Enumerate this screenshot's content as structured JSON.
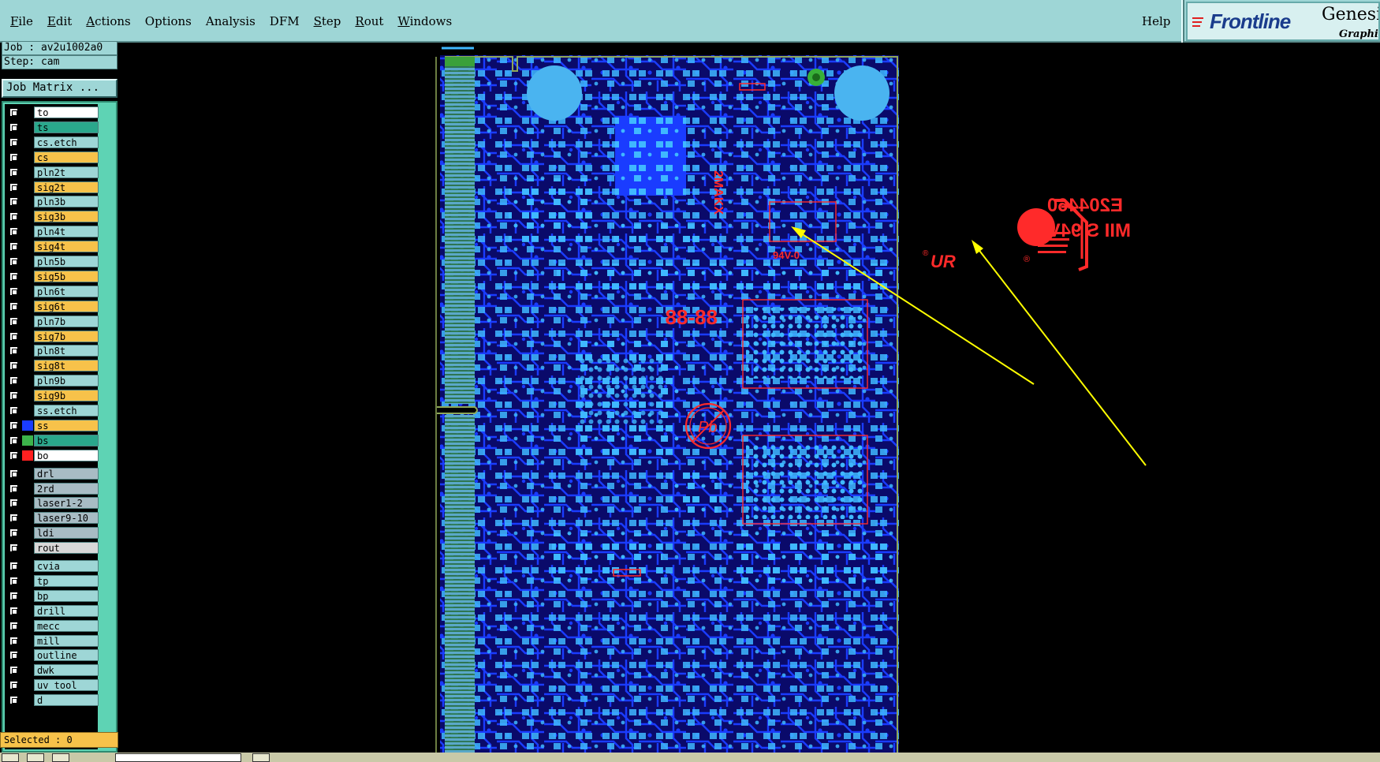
{
  "menu": {
    "items": [
      {
        "label": "File",
        "underline": "F"
      },
      {
        "label": "Edit",
        "underline": "E"
      },
      {
        "label": "Actions",
        "underline": "A"
      },
      {
        "label": "Options",
        "underline": ""
      },
      {
        "label": "Analysis",
        "underline": ""
      },
      {
        "label": "DFM",
        "underline": ""
      },
      {
        "label": "Step",
        "underline": "S"
      },
      {
        "label": "Rout",
        "underline": "R"
      },
      {
        "label": "Windows",
        "underline": "W"
      }
    ],
    "help": "Help"
  },
  "brand": {
    "logo_text": "Frontline",
    "product": "Genesis",
    "subtitle": "Graphic"
  },
  "job": {
    "job_line": "Job : av2u1002a0",
    "step_line": "Step: cam",
    "matrix_button": "Job Matrix ..."
  },
  "layers": [
    {
      "name": "to",
      "bg": "#ffffff",
      "swatch": ""
    },
    {
      "name": "ts",
      "bg": "#2aa88c",
      "swatch": ""
    },
    {
      "name": "cs.etch",
      "bg": "#9ed6d6",
      "swatch": ""
    },
    {
      "name": "cs",
      "bg": "#f7c24a",
      "swatch": ""
    },
    {
      "name": "pln2t",
      "bg": "#9ed6d6",
      "swatch": ""
    },
    {
      "name": "sig2t",
      "bg": "#f7c24a",
      "swatch": ""
    },
    {
      "name": "pln3b",
      "bg": "#9ed6d6",
      "swatch": ""
    },
    {
      "name": "sig3b",
      "bg": "#f7c24a",
      "swatch": ""
    },
    {
      "name": "pln4t",
      "bg": "#9ed6d6",
      "swatch": ""
    },
    {
      "name": "sig4t",
      "bg": "#f7c24a",
      "swatch": ""
    },
    {
      "name": "pln5b",
      "bg": "#9ed6d6",
      "swatch": ""
    },
    {
      "name": "sig5b",
      "bg": "#f7c24a",
      "swatch": ""
    },
    {
      "name": "pln6t",
      "bg": "#9ed6d6",
      "swatch": ""
    },
    {
      "name": "sig6t",
      "bg": "#f7c24a",
      "swatch": ""
    },
    {
      "name": "pln7b",
      "bg": "#9ed6d6",
      "swatch": ""
    },
    {
      "name": "sig7b",
      "bg": "#f7c24a",
      "swatch": ""
    },
    {
      "name": "pln8t",
      "bg": "#9ed6d6",
      "swatch": ""
    },
    {
      "name": "sig8t",
      "bg": "#f7c24a",
      "swatch": ""
    },
    {
      "name": "pln9b",
      "bg": "#9ed6d6",
      "swatch": ""
    },
    {
      "name": "sig9b",
      "bg": "#f7c24a",
      "swatch": ""
    },
    {
      "name": "ss.etch",
      "bg": "#9ed6d6",
      "swatch": ""
    },
    {
      "name": "ss",
      "bg": "#f7c24a",
      "swatch": "#1a3cff"
    },
    {
      "name": "bs",
      "bg": "#2aa88c",
      "swatch": "#3cb44b"
    },
    {
      "name": "bo",
      "bg": "#ffffff",
      "swatch": "#ff2020"
    },
    {
      "name": "drl",
      "bg": "#a8bcc4",
      "swatch": ""
    },
    {
      "name": "2rd",
      "bg": "#a8bcc4",
      "swatch": ""
    },
    {
      "name": "laser1-2",
      "bg": "#a8bcc4",
      "swatch": ""
    },
    {
      "name": "laser9-10",
      "bg": "#a8bcc4",
      "swatch": ""
    },
    {
      "name": "ldi",
      "bg": "#a8bcc4",
      "swatch": ""
    },
    {
      "name": "rout",
      "bg": "#d8d8d8",
      "swatch": ""
    },
    {
      "name": "cvia",
      "bg": "#9ed6d6",
      "swatch": ""
    },
    {
      "name": "tp",
      "bg": "#9ed6d6",
      "swatch": ""
    },
    {
      "name": "bp",
      "bg": "#9ed6d6",
      "swatch": ""
    },
    {
      "name": "drill",
      "bg": "#9ed6d6",
      "swatch": ""
    },
    {
      "name": "mecc",
      "bg": "#9ed6d6",
      "swatch": ""
    },
    {
      "name": "mill",
      "bg": "#9ed6d6",
      "swatch": ""
    },
    {
      "name": "outline",
      "bg": "#9ed6d6",
      "swatch": ""
    },
    {
      "name": "dwk",
      "bg": "#9ed6d6",
      "swatch": ""
    },
    {
      "name": "uv_tool",
      "bg": "#9ed6d6",
      "swatch": ""
    },
    {
      "name": "d",
      "bg": "#9ed6d6",
      "swatch": ""
    }
  ],
  "status": {
    "selected": "Selected : 0"
  },
  "canvas_labels": {
    "ul_code": "E204460",
    "ul_rating": "MII S 94V-0",
    "ul_mark": "UR",
    "date_code": "88-88",
    "pb_symbol": "Pb",
    "board_text": "2MAKX",
    "v0_small": "94V-0"
  },
  "colors": {
    "ui_cyan": "#9ed6d6",
    "layer_panel": "#5ed3b4",
    "signal_yellow": "#f7c24a",
    "board_blue": "#1a3cff",
    "pad_cyan": "#3fb8ff",
    "silk_red": "#ff2a2a",
    "annotation_yellow": "#ffff00"
  }
}
